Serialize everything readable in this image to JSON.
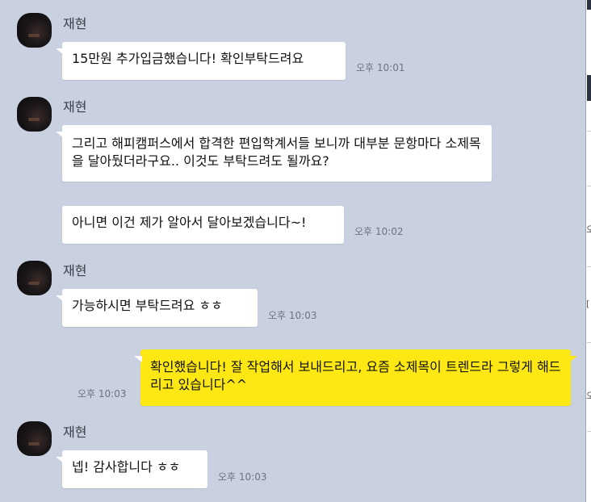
{
  "messages": [
    {
      "sender": "재현",
      "text": "15만원 추가입금했습니다! 확인부탁드려요",
      "time": "오후 10:01"
    },
    {
      "sender": "재현",
      "text": "그리고 해피캠퍼스에서 합격한 편입학계서들 보니까 대부분 문항마다 소제목을 달아뒀더라구요.. 이것도 부탁드려도 될까요?",
      "time": ""
    },
    {
      "sender": "재현",
      "text": "아니면 이건 제가 알아서 달아보겠습니다~!",
      "time": "오후 10:02"
    },
    {
      "sender": "재현",
      "text": "가능하시면 부탁드려요 ㅎㅎ",
      "time": "오후 10:03"
    },
    {
      "sender": "me",
      "text": "확인했습니다! 잘 작업해서 보내드리고, 요즘 소제목이 트렌드라 그렇게 해드리고 있습니다^^",
      "time": "오후 10:03"
    },
    {
      "sender": "재현",
      "text": "넵! 감사합니다 ㅎㅎ",
      "time": "오후 10:03"
    }
  ],
  "side_chars": [
    "오",
    "[",
    "오"
  ],
  "colors": {
    "background": "#c9d0df",
    "other_bubble": "#ffffff",
    "my_bubble": "#fee814"
  }
}
